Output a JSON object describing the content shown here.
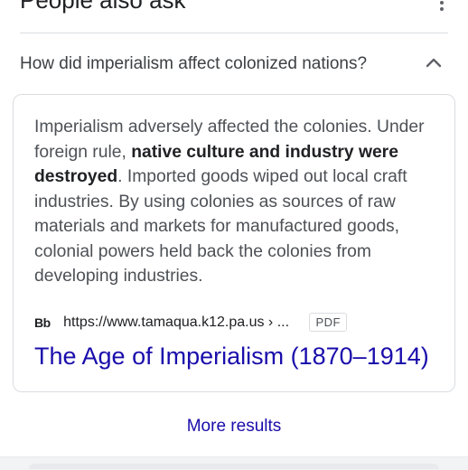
{
  "section": {
    "title": "People also ask",
    "menu_icon": "more-vert-icon"
  },
  "question": {
    "text": "How did imperialism affect colonized nations?",
    "toggle_icon": "chevron-up-icon",
    "expanded": true
  },
  "answer": {
    "part1": "Imperialism adversely affected the colonies. Under foreign rule, ",
    "bold": "native culture and industry were destroyed",
    "part2": ". Imported goods wiped out local craft industries. By using colonies as sources of raw materials and markets for manufactured goods, colonial powers held back the colonies from developing industries."
  },
  "source": {
    "favicon_text": "Bb",
    "url": "https://www.tamaqua.k12.pa.us › ...",
    "badge": "PDF",
    "title": "The Age of Imperialism (1870–1914)"
  },
  "more_results": {
    "label": "More results"
  },
  "colors": {
    "link": "#1a0dab",
    "text_primary": "#202124",
    "text_secondary": "#4d5156",
    "border": "#dadce0"
  }
}
